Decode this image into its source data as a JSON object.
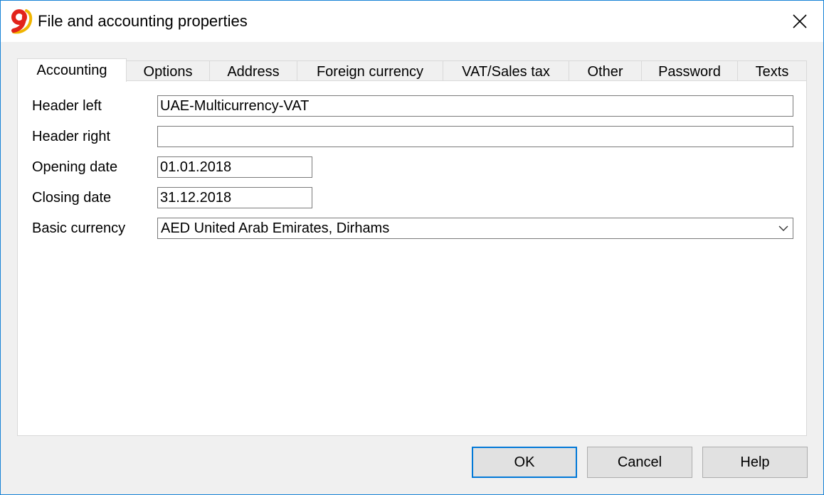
{
  "window": {
    "title": "File and accounting properties",
    "accent_color": "#1883d7"
  },
  "tabs": [
    {
      "label": "Accounting",
      "active": true
    },
    {
      "label": "Options",
      "active": false
    },
    {
      "label": "Address",
      "active": false
    },
    {
      "label": "Foreign currency",
      "active": false
    },
    {
      "label": "VAT/Sales tax",
      "active": false
    },
    {
      "label": "Other",
      "active": false
    },
    {
      "label": "Password",
      "active": false
    },
    {
      "label": "Texts",
      "active": false
    }
  ],
  "form": {
    "header_left": {
      "label": "Header left",
      "value": "UAE-Multicurrency-VAT"
    },
    "header_right": {
      "label": "Header right",
      "value": ""
    },
    "opening_date": {
      "label": "Opening date",
      "value": "01.01.2018"
    },
    "closing_date": {
      "label": "Closing date",
      "value": "31.12.2018"
    },
    "basic_currency": {
      "label": "Basic currency",
      "value": "AED United Arab Emirates, Dirhams"
    }
  },
  "buttons": {
    "ok": "OK",
    "cancel": "Cancel",
    "help": "Help"
  }
}
